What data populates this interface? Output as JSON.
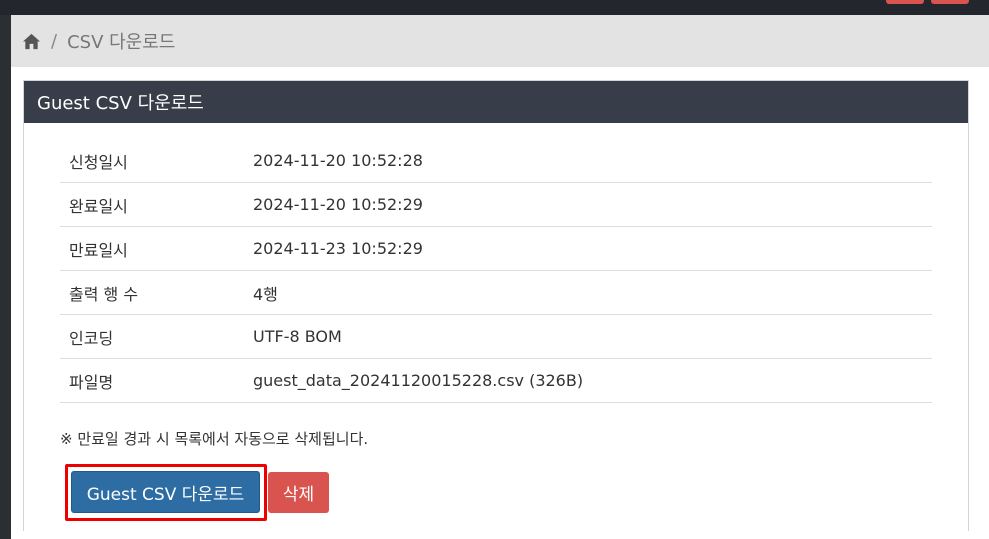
{
  "breadcrumb": {
    "current": "CSV 다운로드",
    "separator": "/"
  },
  "panel": {
    "title": "Guest CSV 다운로드"
  },
  "rows": [
    {
      "label": "신청일시",
      "value": "2024-11-20 10:52:28"
    },
    {
      "label": "완료일시",
      "value": "2024-11-20 10:52:29"
    },
    {
      "label": "만료일시",
      "value": "2024-11-23 10:52:29"
    },
    {
      "label": "출력 행 수",
      "value": "4행"
    },
    {
      "label": "인코딩",
      "value": "UTF-8 BOM"
    },
    {
      "label": "파일명",
      "value": "guest_data_20241120015228.csv (326B)"
    }
  ],
  "notice": "※ 만료일 경과 시 목록에서 자동으로 삭제됩니다.",
  "buttons": {
    "download": "Guest CSV 다운로드",
    "delete": "삭제"
  },
  "colors": {
    "panel_header": "#373d49",
    "primary": "#2d6da3",
    "danger": "#d9534f",
    "highlight": "#ee0000"
  },
  "icons": {
    "home": "home-icon"
  }
}
